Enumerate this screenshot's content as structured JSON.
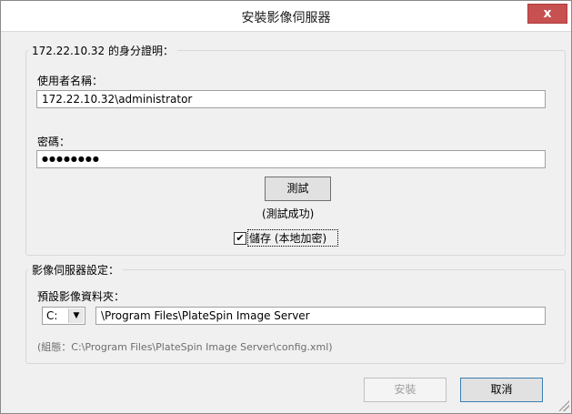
{
  "window": {
    "title": "安裝影像伺服器",
    "close_label": "x"
  },
  "credentials": {
    "legend": "172.22.10.32 的身分證明：",
    "username_label": "使用者名稱：",
    "username_value": "172.22.10.32\\administrator",
    "password_label": "密碼：",
    "password_value": "●●●●●●●●",
    "test_button": "測試",
    "test_status": "(測試成功)",
    "save_checked": true,
    "save_check_mark": "✔",
    "save_label": "儲存 (本地加密)"
  },
  "server_settings": {
    "legend": "影像伺服器設定：",
    "folder_label": "預設影像資料夾：",
    "drive_value": "C:",
    "drive_arrow": "▼",
    "path_value": "\\Program Files\\PlateSpin Image Server",
    "config_note": "(組態：C:\\Program Files\\PlateSpin Image Server\\config.xml)"
  },
  "footer": {
    "install_button": "安裝",
    "cancel_button": "取消"
  }
}
